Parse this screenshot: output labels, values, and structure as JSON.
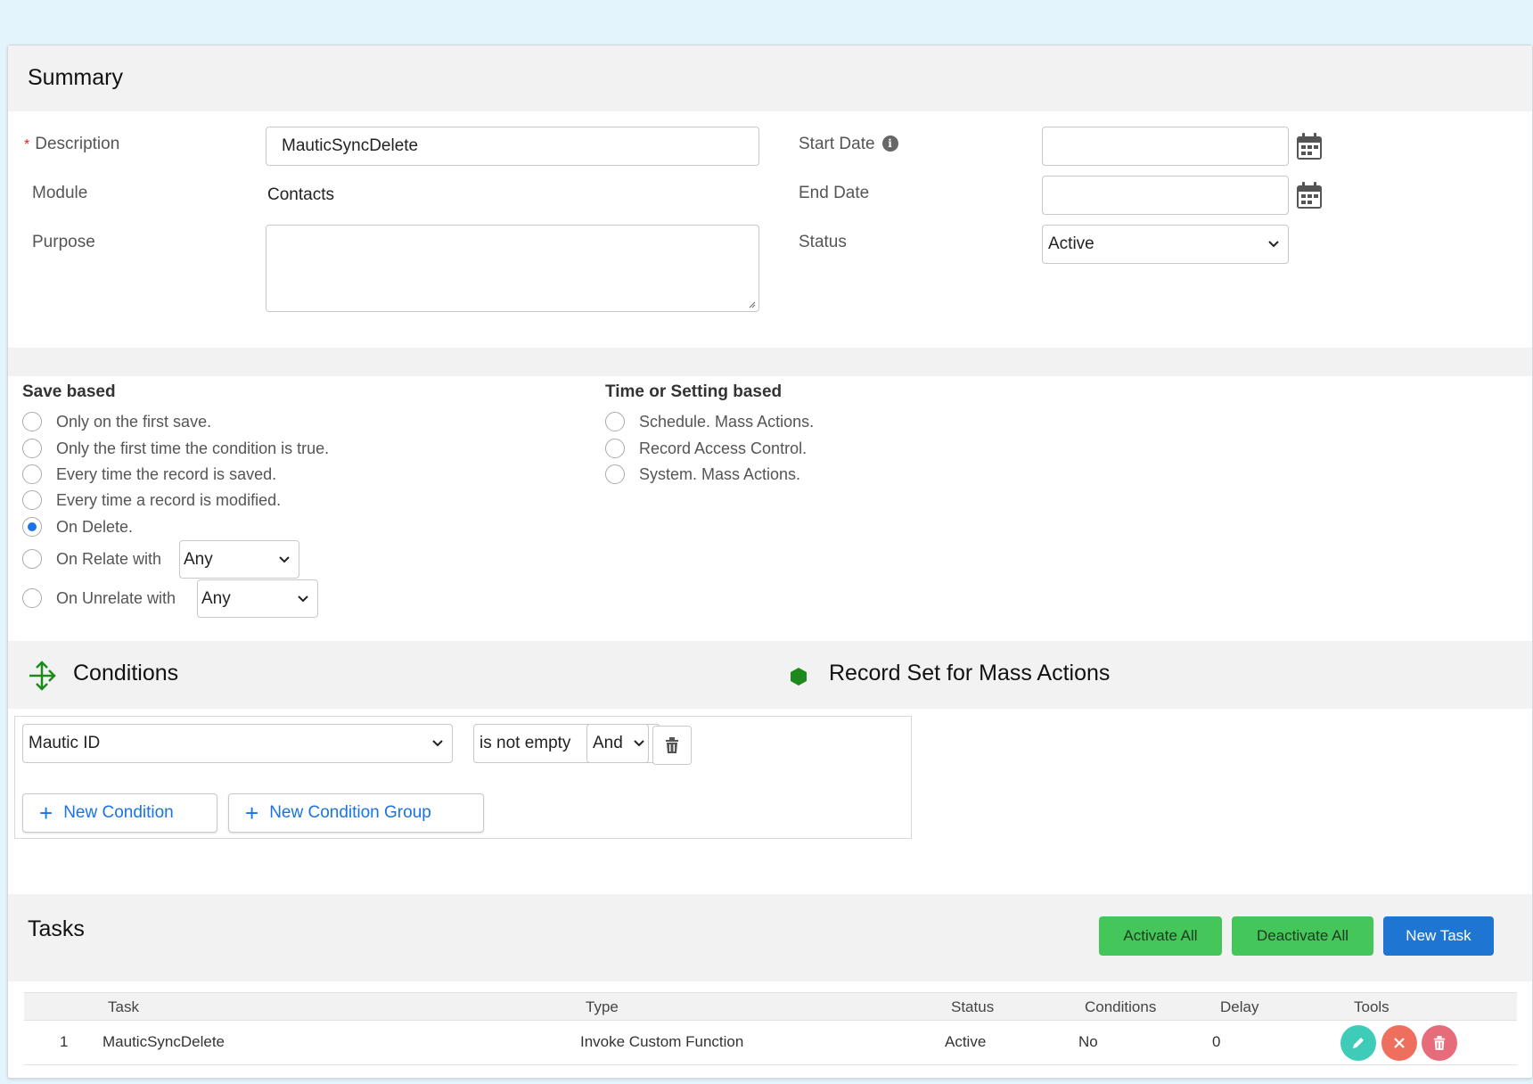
{
  "summary": {
    "title": "Summary",
    "description_label": "Description",
    "description_required_mark": "*",
    "description_value": "MauticSyncDelete",
    "module_label": "Module",
    "module_value": "Contacts",
    "purpose_label": "Purpose",
    "purpose_value": "",
    "start_date_label": "Start Date",
    "start_date_value": "",
    "end_date_label": "End Date",
    "end_date_value": "",
    "status_label": "Status",
    "status_value": "Active"
  },
  "triggers": {
    "save_based": {
      "title": "Save based",
      "options": [
        {
          "label": "Only on the first save.",
          "checked": false
        },
        {
          "label": "Only the first time the condition is true.",
          "checked": false
        },
        {
          "label": "Every time the record is saved.",
          "checked": false
        },
        {
          "label": "Every time a record is modified.",
          "checked": false
        },
        {
          "label": "On Delete.",
          "checked": true
        },
        {
          "label": "On Relate with",
          "checked": false,
          "select_value": "Any"
        },
        {
          "label": "On Unrelate with",
          "checked": false,
          "select_value": "Any"
        }
      ]
    },
    "time_based": {
      "title": "Time or Setting based",
      "options": [
        {
          "label": "Schedule. Mass Actions.",
          "checked": false
        },
        {
          "label": "Record Access Control.",
          "checked": false
        },
        {
          "label": "System. Mass Actions.",
          "checked": false
        }
      ]
    }
  },
  "conditions": {
    "title": "Conditions",
    "record_set_title": "Record Set for Mass Actions",
    "field_value": "Mautic ID",
    "operator_value": "is not empty",
    "logic_value": "And",
    "new_condition_label": "New Condition",
    "new_condition_group_label": "New Condition Group",
    "icon_color": "#1e8a1e"
  },
  "tasks": {
    "title": "Tasks",
    "activate_all_label": "Activate All",
    "deactivate_all_label": "Deactivate All",
    "new_task_label": "New Task",
    "columns": [
      "Task",
      "Type",
      "Status",
      "Conditions",
      "Delay",
      "Tools"
    ],
    "rows": [
      {
        "index": "1",
        "task": "MauticSyncDelete",
        "type": "Invoke Custom Function",
        "status": "Active",
        "conditions": "No",
        "delay": "0"
      }
    ],
    "tool_colors": {
      "edit": "#3ecbb8",
      "deactivate": "#ef6f5e",
      "delete": "#e76c7a"
    }
  }
}
